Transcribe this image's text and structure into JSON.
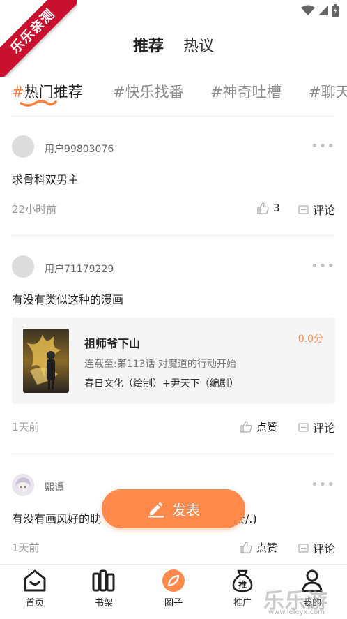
{
  "corner_banner": {
    "text": "乐乐亲测"
  },
  "header_tabs": [
    {
      "label": "推荐",
      "active": true
    },
    {
      "label": "热议",
      "active": false
    }
  ],
  "topics": [
    {
      "hash": "#",
      "label": "热门推荐",
      "active": true
    },
    {
      "hash": "#",
      "label": "快乐找番",
      "active": false
    },
    {
      "hash": "#",
      "label": "神奇吐槽",
      "active": false
    },
    {
      "hash": "#",
      "label": "聊天",
      "active": false
    }
  ],
  "posts": [
    {
      "user": "用户99803076",
      "text": "求骨科双男主",
      "time": "22小时前",
      "like_label": "3",
      "comment_label": "评论"
    },
    {
      "user": "用户71179229",
      "text": "有没有类似这种的漫画",
      "time": "1天前",
      "like_label": "点赞",
      "comment_label": "评论",
      "comic": {
        "title": "祖师爷下山",
        "score": "0.0分",
        "update": "连载至:第113话 对魔道的行动开始",
        "credits": "春日文化（绘制）+尹天下（编剧）"
      }
    },
    {
      "user": "熙谭",
      "text_left": "有没有画风好的耽",
      "text_right": "套/.)",
      "time": "1天前",
      "like_label": "点赞",
      "comment_label": "评论"
    }
  ],
  "publish_button": {
    "label": "发表"
  },
  "bottom_nav": [
    {
      "label": "首页",
      "icon": "home-smile-icon",
      "active": false
    },
    {
      "label": "书架",
      "icon": "bookshelf-icon",
      "active": false
    },
    {
      "label": "圈子",
      "icon": "circle-leaf-icon",
      "active": true
    },
    {
      "label": "推广",
      "icon": "money-bag-icon",
      "active": false
    },
    {
      "label": "我的",
      "icon": "person-icon",
      "active": false
    }
  ],
  "watermark": {
    "text": "乐乐游戏",
    "url": "www.leleyx.com"
  },
  "colors": {
    "accent": "#ff8a4c",
    "hash_accent": "#ff7f3f",
    "banner": "#c8102e"
  }
}
